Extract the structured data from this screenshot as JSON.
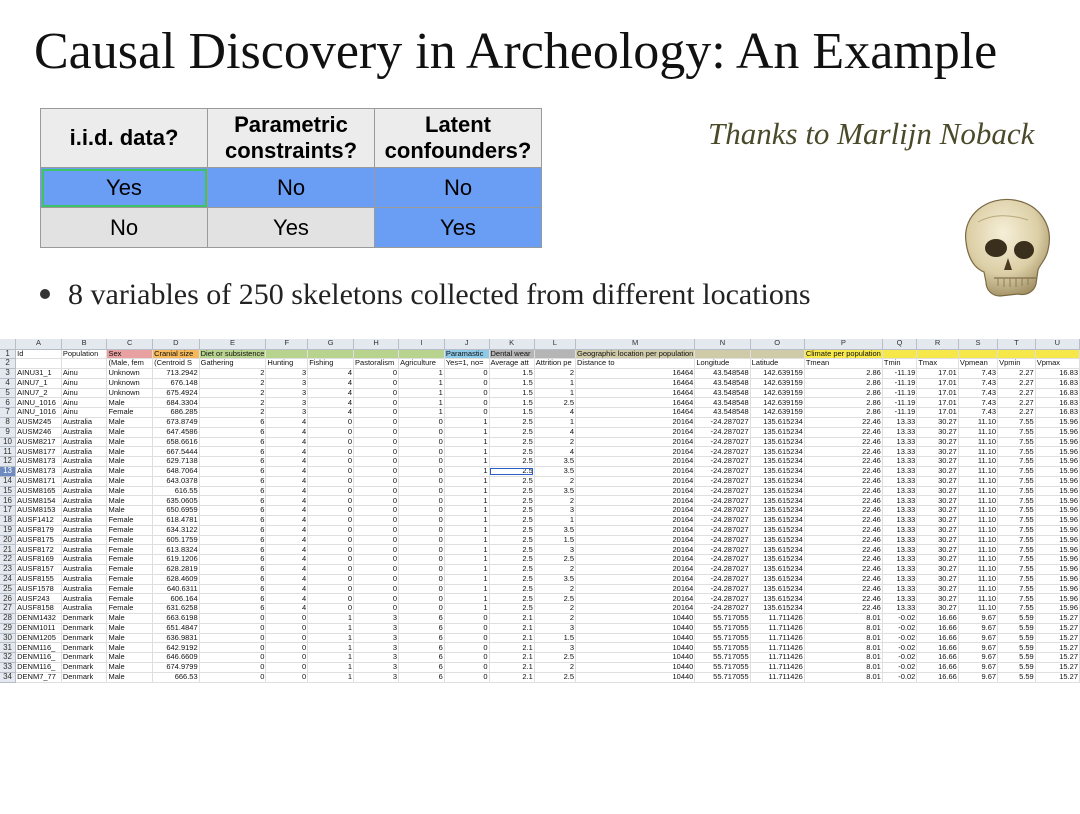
{
  "slide": {
    "title": "Causal Discovery in Archeology: An Example",
    "thanks": "Thanks to Marlijn Noback",
    "bullet": "8 variables of 250 skeletons collected from different locations",
    "skull_image": "skull-illustration"
  },
  "summary_table": {
    "headers": [
      "i.i.d. data?",
      "Parametric constraints?",
      "Latent confounders?"
    ],
    "rows": [
      [
        "Yes",
        "No",
        "No"
      ],
      [
        "No",
        "Yes",
        "Yes"
      ]
    ],
    "colors": {
      "blue": "#6a9ef5",
      "gray": "#e2e2e2",
      "selected_border": "#3ec468"
    }
  },
  "spreadsheet": {
    "columns": [
      "A",
      "B",
      "C",
      "D",
      "E",
      "F",
      "G",
      "H",
      "I",
      "J",
      "K",
      "L",
      "M",
      "N",
      "O",
      "P",
      "Q",
      "R",
      "S",
      "T",
      "U"
    ],
    "selected_column": "K",
    "selected_row": "13",
    "row_numbers": [
      "1",
      "2",
      "3",
      "4",
      "5",
      "6",
      "7",
      "8",
      "9",
      "10",
      "11",
      "12",
      "13",
      "14",
      "15",
      "16",
      "17",
      "18",
      "19",
      "20",
      "21",
      "22",
      "23",
      "24",
      "25",
      "26",
      "27",
      "28",
      "29",
      "30",
      "31",
      "32",
      "33",
      "34"
    ],
    "header_row1": [
      "Id",
      "Population",
      "Sex",
      "Cranial size",
      "Diet or subsistence",
      "",
      "",
      "",
      "",
      "Paramastic",
      "Dental wear",
      "",
      "Geographic location per population",
      "",
      "",
      "Climate per population",
      "",
      "",
      "",
      "",
      ""
    ],
    "header_row2": [
      "",
      "",
      "(Male, fem",
      "(Centroid S",
      "Gathering",
      "Hunting",
      "Fishing",
      "Pastoralism",
      "Agriculture",
      "Yes=1, no=",
      "Average att",
      "Attrition pe",
      "Distance to",
      "Longitude",
      "Latitude",
      "Tmean",
      "Tmin",
      "Tmax",
      "Vpmean",
      "Vpmin",
      "Vpmax"
    ],
    "rows": [
      [
        "AINU31_1",
        "Ainu",
        "Unknown",
        "713.2942",
        "2",
        "3",
        "4",
        "0",
        "1",
        "0",
        "1.5",
        "2",
        "16464",
        "43.548548",
        "142.639159",
        "2.86",
        "-11.19",
        "17.01",
        "7.43",
        "2.27",
        "16.83"
      ],
      [
        "AINU7_1",
        "Ainu",
        "Unknown",
        "676.148",
        "2",
        "3",
        "4",
        "0",
        "1",
        "0",
        "1.5",
        "1",
        "16464",
        "43.548548",
        "142.639159",
        "2.86",
        "-11.19",
        "17.01",
        "7.43",
        "2.27",
        "16.83"
      ],
      [
        "AINU7_2",
        "Ainu",
        "Unknown",
        "675.4924",
        "2",
        "3",
        "4",
        "0",
        "1",
        "0",
        "1.5",
        "1",
        "16464",
        "43.548548",
        "142.639159",
        "2.86",
        "-11.19",
        "17.01",
        "7.43",
        "2.27",
        "16.83"
      ],
      [
        "AINU_1016",
        "Ainu",
        "Male",
        "684.3304",
        "2",
        "3",
        "4",
        "0",
        "1",
        "0",
        "1.5",
        "2.5",
        "16464",
        "43.548548",
        "142.639159",
        "2.86",
        "-11.19",
        "17.01",
        "7.43",
        "2.27",
        "16.83"
      ],
      [
        "AINU_1016",
        "Ainu",
        "Female",
        "686.285",
        "2",
        "3",
        "4",
        "0",
        "1",
        "0",
        "1.5",
        "4",
        "16464",
        "43.548548",
        "142.639159",
        "2.86",
        "-11.19",
        "17.01",
        "7.43",
        "2.27",
        "16.83"
      ],
      [
        "AUSM245",
        "Australia",
        "Male",
        "673.8749",
        "6",
        "4",
        "0",
        "0",
        "0",
        "1",
        "2.5",
        "1",
        "20164",
        "-24.287027",
        "135.615234",
        "22.46",
        "13.33",
        "30.27",
        "11.10",
        "7.55",
        "15.96"
      ],
      [
        "AUSM246",
        "Australia",
        "Male",
        "647.4586",
        "6",
        "4",
        "0",
        "0",
        "0",
        "1",
        "2.5",
        "4",
        "20164",
        "-24.287027",
        "135.615234",
        "22.46",
        "13.33",
        "30.27",
        "11.10",
        "7.55",
        "15.96"
      ],
      [
        "AUSM8217",
        "Australia",
        "Male",
        "658.6616",
        "6",
        "4",
        "0",
        "0",
        "0",
        "1",
        "2.5",
        "2",
        "20164",
        "-24.287027",
        "135.615234",
        "22.46",
        "13.33",
        "30.27",
        "11.10",
        "7.55",
        "15.96"
      ],
      [
        "AUSM8177",
        "Australia",
        "Male",
        "667.5444",
        "6",
        "4",
        "0",
        "0",
        "0",
        "1",
        "2.5",
        "4",
        "20164",
        "-24.287027",
        "135.615234",
        "22.46",
        "13.33",
        "30.27",
        "11.10",
        "7.55",
        "15.96"
      ],
      [
        "AUSM8173",
        "Australia",
        "Male",
        "629.7138",
        "6",
        "4",
        "0",
        "0",
        "0",
        "1",
        "2.5",
        "3.5",
        "20164",
        "-24.287027",
        "135.615234",
        "22.46",
        "13.33",
        "30.27",
        "11.10",
        "7.55",
        "15.96"
      ],
      [
        "AUSM8173",
        "Australia",
        "Male",
        "648.7064",
        "6",
        "4",
        "0",
        "0",
        "0",
        "1",
        "2.5",
        "3.5",
        "20164",
        "-24.287027",
        "135.615234",
        "22.46",
        "13.33",
        "30.27",
        "11.10",
        "7.55",
        "15.96"
      ],
      [
        "AUSM8171",
        "Australia",
        "Male",
        "643.0378",
        "6",
        "4",
        "0",
        "0",
        "0",
        "1",
        "2.5",
        "2",
        "20164",
        "-24.287027",
        "135.615234",
        "22.46",
        "13.33",
        "30.27",
        "11.10",
        "7.55",
        "15.96"
      ],
      [
        "AUSM8165",
        "Australia",
        "Male",
        "616.55",
        "6",
        "4",
        "0",
        "0",
        "0",
        "1",
        "2.5",
        "3.5",
        "20164",
        "-24.287027",
        "135.615234",
        "22.46",
        "13.33",
        "30.27",
        "11.10",
        "7.55",
        "15.96"
      ],
      [
        "AUSM8154",
        "Australia",
        "Male",
        "635.0605",
        "6",
        "4",
        "0",
        "0",
        "0",
        "1",
        "2.5",
        "2",
        "20164",
        "-24.287027",
        "135.615234",
        "22.46",
        "13.33",
        "30.27",
        "11.10",
        "7.55",
        "15.96"
      ],
      [
        "AUSM8153",
        "Australia",
        "Male",
        "650.6959",
        "6",
        "4",
        "0",
        "0",
        "0",
        "1",
        "2.5",
        "3",
        "20164",
        "-24.287027",
        "135.615234",
        "22.46",
        "13.33",
        "30.27",
        "11.10",
        "7.55",
        "15.96"
      ],
      [
        "AUSF1412",
        "Australia",
        "Female",
        "618.4781",
        "6",
        "4",
        "0",
        "0",
        "0",
        "1",
        "2.5",
        "1",
        "20164",
        "-24.287027",
        "135.615234",
        "22.46",
        "13.33",
        "30.27",
        "11.10",
        "7.55",
        "15.96"
      ],
      [
        "AUSF8179",
        "Australia",
        "Female",
        "634.3122",
        "6",
        "4",
        "0",
        "0",
        "0",
        "1",
        "2.5",
        "3.5",
        "20164",
        "-24.287027",
        "135.615234",
        "22.46",
        "13.33",
        "30.27",
        "11.10",
        "7.55",
        "15.96"
      ],
      [
        "AUSF8175",
        "Australia",
        "Female",
        "605.1759",
        "6",
        "4",
        "0",
        "0",
        "0",
        "1",
        "2.5",
        "1.5",
        "20164",
        "-24.287027",
        "135.615234",
        "22.46",
        "13.33",
        "30.27",
        "11.10",
        "7.55",
        "15.96"
      ],
      [
        "AUSF8172",
        "Australia",
        "Female",
        "613.8324",
        "6",
        "4",
        "0",
        "0",
        "0",
        "1",
        "2.5",
        "3",
        "20164",
        "-24.287027",
        "135.615234",
        "22.46",
        "13.33",
        "30.27",
        "11.10",
        "7.55",
        "15.96"
      ],
      [
        "AUSF8169",
        "Australia",
        "Female",
        "619.1206",
        "6",
        "4",
        "0",
        "0",
        "0",
        "1",
        "2.5",
        "2.5",
        "20164",
        "-24.287027",
        "135.615234",
        "22.46",
        "13.33",
        "30.27",
        "11.10",
        "7.55",
        "15.96"
      ],
      [
        "AUSF8157",
        "Australia",
        "Female",
        "628.2819",
        "6",
        "4",
        "0",
        "0",
        "0",
        "1",
        "2.5",
        "2",
        "20164",
        "-24.287027",
        "135.615234",
        "22.46",
        "13.33",
        "30.27",
        "11.10",
        "7.55",
        "15.96"
      ],
      [
        "AUSF8155",
        "Australia",
        "Female",
        "628.4609",
        "6",
        "4",
        "0",
        "0",
        "0",
        "1",
        "2.5",
        "3.5",
        "20164",
        "-24.287027",
        "135.615234",
        "22.46",
        "13.33",
        "30.27",
        "11.10",
        "7.55",
        "15.96"
      ],
      [
        "AUSF1578",
        "Australia",
        "Female",
        "640.6311",
        "6",
        "4",
        "0",
        "0",
        "0",
        "1",
        "2.5",
        "2",
        "20164",
        "-24.287027",
        "135.615234",
        "22.46",
        "13.33",
        "30.27",
        "11.10",
        "7.55",
        "15.96"
      ],
      [
        "AUSF243",
        "Australia",
        "Female",
        "606.164",
        "6",
        "4",
        "0",
        "0",
        "0",
        "1",
        "2.5",
        "2.5",
        "20164",
        "-24.287027",
        "135.615234",
        "22.46",
        "13.33",
        "30.27",
        "11.10",
        "7.55",
        "15.96"
      ],
      [
        "AUSF8158",
        "Australia",
        "Female",
        "631.6258",
        "6",
        "4",
        "0",
        "0",
        "0",
        "1",
        "2.5",
        "2",
        "20164",
        "-24.287027",
        "135.615234",
        "22.46",
        "13.33",
        "30.27",
        "11.10",
        "7.55",
        "15.96"
      ],
      [
        "DENM1432",
        "Denmark",
        "Male",
        "663.6198",
        "0",
        "0",
        "1",
        "3",
        "6",
        "0",
        "2.1",
        "2",
        "10440",
        "55.717055",
        "11.711426",
        "8.01",
        "-0.02",
        "16.66",
        "9.67",
        "5.59",
        "15.27"
      ],
      [
        "DENM1011",
        "Denmark",
        "Male",
        "651.4847",
        "0",
        "0",
        "1",
        "3",
        "6",
        "0",
        "2.1",
        "3",
        "10440",
        "55.717055",
        "11.711426",
        "8.01",
        "-0.02",
        "16.66",
        "9.67",
        "5.59",
        "15.27"
      ],
      [
        "DENM1205",
        "Denmark",
        "Male",
        "636.9831",
        "0",
        "0",
        "1",
        "3",
        "6",
        "0",
        "2.1",
        "1.5",
        "10440",
        "55.717055",
        "11.711426",
        "8.01",
        "-0.02",
        "16.66",
        "9.67",
        "5.59",
        "15.27"
      ],
      [
        "DENM116_",
        "Denmark",
        "Male",
        "642.9192",
        "0",
        "0",
        "1",
        "3",
        "6",
        "0",
        "2.1",
        "3",
        "10440",
        "55.717055",
        "11.711426",
        "8.01",
        "-0.02",
        "16.66",
        "9.67",
        "5.59",
        "15.27"
      ],
      [
        "DENM116_",
        "Denmark",
        "Male",
        "646.6609",
        "0",
        "0",
        "1",
        "3",
        "6",
        "0",
        "2.1",
        "2.5",
        "10440",
        "55.717055",
        "11.711426",
        "8.01",
        "-0.02",
        "16.66",
        "9.67",
        "5.59",
        "15.27"
      ],
      [
        "DENM116_",
        "Denmark",
        "Male",
        "674.9799",
        "0",
        "0",
        "1",
        "3",
        "6",
        "0",
        "2.1",
        "2",
        "10440",
        "55.717055",
        "11.711426",
        "8.01",
        "-0.02",
        "16.66",
        "9.67",
        "5.59",
        "15.27"
      ],
      [
        "DENM7_77",
        "Denmark",
        "Male",
        "666.53",
        "0",
        "0",
        "1",
        "3",
        "6",
        "0",
        "2.1",
        "2.5",
        "10440",
        "55.717055",
        "11.711426",
        "8.01",
        "-0.02",
        "16.66",
        "9.67",
        "5.59",
        "15.27"
      ]
    ]
  }
}
